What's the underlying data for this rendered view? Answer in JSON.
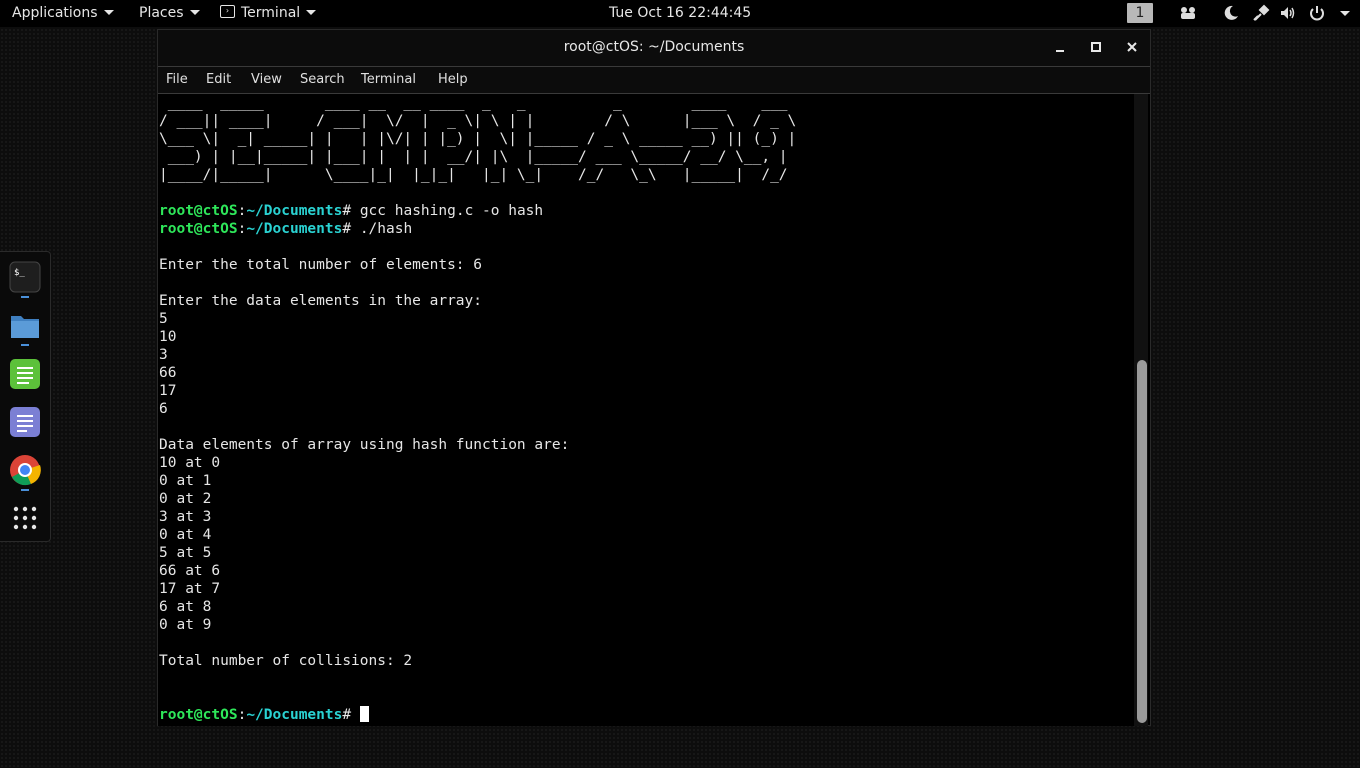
{
  "topbar": {
    "applications_label": "Applications",
    "places_label": "Places",
    "terminal_label": "Terminal",
    "clock": "Tue Oct 16  22:44:45",
    "workspace": "1"
  },
  "dock": {
    "items": [
      {
        "icon": "terminal-icon"
      },
      {
        "icon": "files-folder-icon"
      },
      {
        "icon": "spreadsheet-icon"
      },
      {
        "icon": "text-editor-icon"
      },
      {
        "icon": "chrome-icon"
      },
      {
        "icon": "app-grid-icon"
      }
    ]
  },
  "window": {
    "title": "root@ctOS: ~/Documents",
    "menu": [
      "File",
      "Edit",
      "View",
      "Search",
      "Terminal",
      "Help"
    ]
  },
  "terminal": {
    "banner": [
      " ____  _____       ____ __  __ ____  _   _          _        ____    ___  ",
      "/ ___|| ____|     / ___|  \\/  |  _ \\| \\ | |        / \\      |___ \\  / _ \\ ",
      "\\___ \\|  _| _____| |   | |\\/| | |_) |  \\| |_____ / _ \\ _____ __) || (_) |",
      " ___) | |__|_____| |___| |  | |  __/| |\\  |_____/ ___ \\_____/ __/ \\__, |",
      "|____/|_____|      \\____|_|  |_|_|   |_| \\_|    /_/   \\_\\   |_____|  /_/ "
    ],
    "prompt_user": "root@ctOS",
    "prompt_colon": ":",
    "prompt_path": "~/Documents",
    "prompt_hash": "# ",
    "cmd1": "gcc hashing.c -o hash",
    "cmd2": "./hash",
    "output": [
      "",
      "Enter the total number of elements: 6",
      "",
      "Enter the data elements in the array:",
      "5",
      "10",
      "3",
      "66",
      "17",
      "6",
      "",
      "Data elements of array using hash function are:",
      "10 at 0",
      "0 at 1",
      "0 at 2",
      "3 at 3",
      "0 at 4",
      "5 at 5",
      "66 at 6",
      "17 at 7",
      "6 at 8",
      "0 at 9",
      "",
      "Total number of collisions: 2",
      "",
      ""
    ],
    "scroll_position": 0.55
  }
}
